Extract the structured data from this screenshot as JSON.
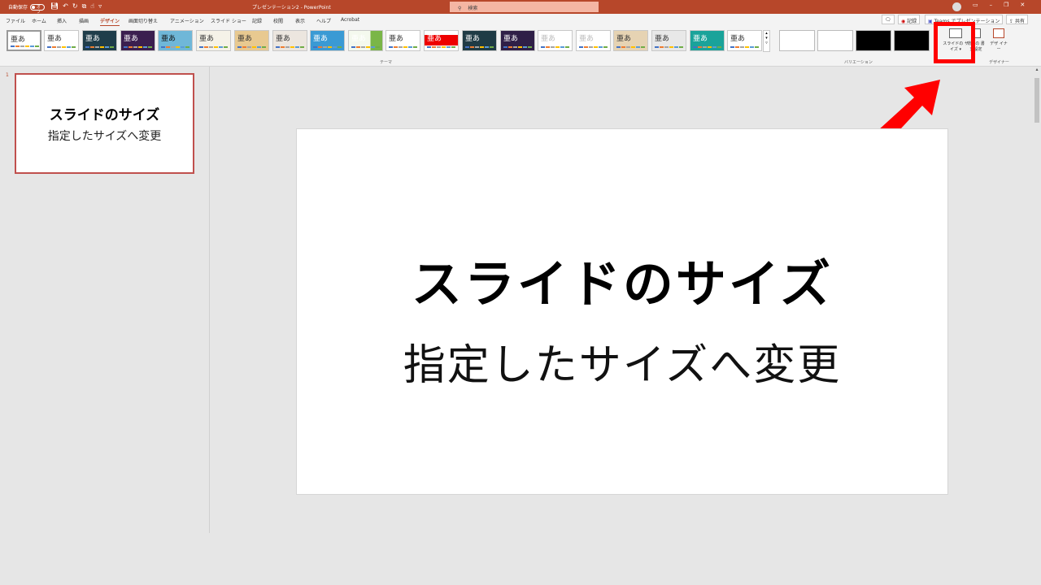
{
  "titlebar": {
    "autosave_label": "自動保存",
    "autosave_state": "オフ",
    "title": "プレゼンテーション2  -  PowerPoint",
    "search_placeholder": "検索",
    "background": "#b7472a"
  },
  "tabs": [
    "ファイル",
    "ホーム",
    "挿入",
    "描画",
    "デザイン",
    "画面切り替え",
    "アニメーション",
    "スライド ショー",
    "記録",
    "校閲",
    "表示",
    "ヘルプ",
    "Acrobat"
  ],
  "active_tab": "デザイン",
  "right_buttons": {
    "record": "記録",
    "teams": "Teams でプレゼンテーション",
    "share": "共有"
  },
  "ribbon": {
    "theme_sample_text": "亜あ",
    "themes_group_label": "テーマ",
    "variants_group_label": "バリエーション",
    "designer_group_label": "デザイナー",
    "slide_size_label": "スライドの サイズ ▾",
    "format_background_label": "背景の 書式設定",
    "designer_label": "デザ イナー",
    "accent_colors": [
      "#4472c4",
      "#ed7d31",
      "#a5a5a5",
      "#ffc000",
      "#5b9bd5",
      "#70ad47"
    ]
  },
  "thumbnail": {
    "number": "1",
    "title": "スライドのサイズ",
    "subtitle": "指定したサイズへ変更"
  },
  "slide": {
    "title": "スライドのサイズ",
    "subtitle": "指定したサイズへ変更"
  },
  "annotation": {
    "arrow_color": "#ff0000"
  }
}
